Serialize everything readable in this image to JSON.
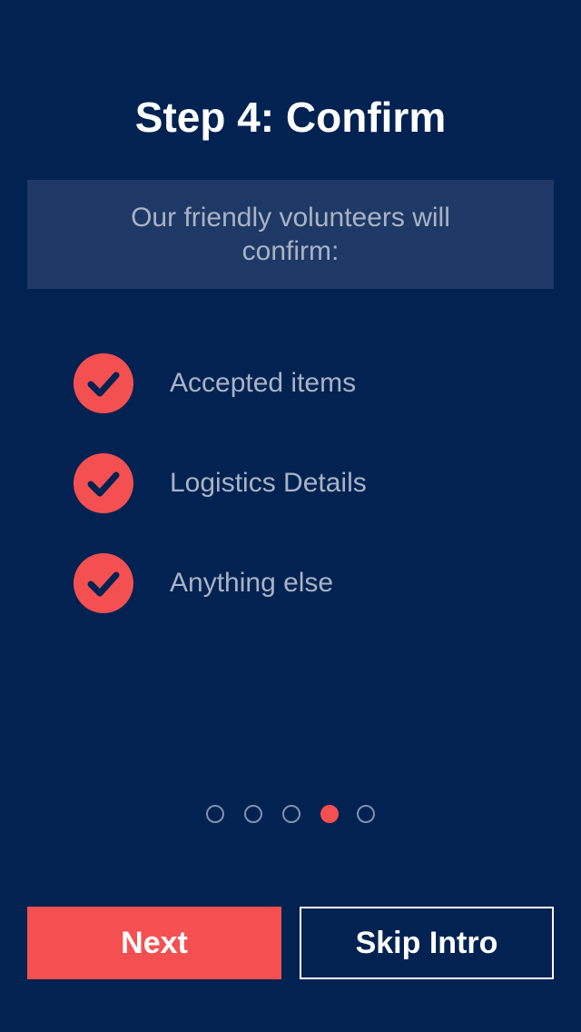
{
  "title": "Step 4: Confirm",
  "intro": "Our friendly volunteers will confirm:",
  "checklist": [
    {
      "label": "Accepted items",
      "icon": "check-circle-icon"
    },
    {
      "label": "Logistics Details",
      "icon": "check-circle-icon"
    },
    {
      "label": "Anything else",
      "icon": "check-circle-icon"
    }
  ],
  "pagination": {
    "total": 5,
    "current": 4
  },
  "buttons": {
    "next": "Next",
    "skip": "Skip Intro"
  },
  "colors": {
    "background": "#022252",
    "panel": "#1e3966",
    "accent": "#f45052",
    "muted_text": "#a9b3c5",
    "dot_outline": "#8292ac"
  }
}
